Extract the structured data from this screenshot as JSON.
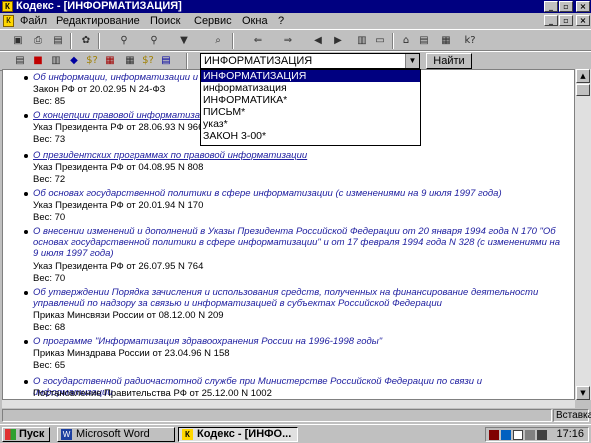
{
  "window": {
    "title": "Кодекс - [ИНФОРМАТИЗАЦИЯ]",
    "minimize": "_",
    "maximize": "▫",
    "close": "×"
  },
  "menu": [
    "Файл",
    "Редактирование",
    "Поиск",
    "Сервис",
    "Окна",
    "?"
  ],
  "search": {
    "value": "ИНФОРМАТИЗАЦИЯ",
    "button_label": "Найти",
    "options": [
      "ИНФОРМАТИЗАЦИЯ",
      "информатизация",
      "ИНФОРМАТИКА*",
      "ПИСЬМ*",
      "указ*",
      "ЗАКОН 3-00*"
    ]
  },
  "documents": [
    {
      "title": "Об информации, информатизации и защите информации",
      "info": "Закон РФ от 20.02.95 N 24-ФЗ",
      "weight": "Вес: 85",
      "underline": false
    },
    {
      "title": "О концепции правовой информатизации России",
      "info": "Указ Президента РФ от 28.06.93 N 966",
      "weight": "Вес: 73",
      "underline": true
    },
    {
      "title": "О президентских программах по правовой информатизации",
      "info": "Указ Президента РФ от 04.08.95 N 808",
      "weight": "Вес: 72",
      "underline": true
    },
    {
      "title": "Об основах государственной политики в сфере информатизации (с изменениями на 9 июля 1997 года)",
      "info": "Указ Президента РФ от 20.01.94 N 170",
      "weight": "Вес: 70",
      "underline": false
    },
    {
      "title": "О внесении изменений и дополнений в Указы Президента Российской Федерации от 20 января 1994 года N 170 \"Об основах государственной политики в сфере информатизации\" и от 17 февраля 1994 года N 328 (с изменениями на 9 июля 1997 года)",
      "info": "Указ Президента РФ от 26.07.95 N 764",
      "weight": "Вес: 70",
      "underline": false
    },
    {
      "title": "Об утверждении Порядка зачисления и использования средств, полученных на финансирование деятельности управлений по надзору за связью и информатизацией в субъектах Российской Федерации",
      "info": "Приказ Минсвязи России от 08.12.00 N 209",
      "weight": "Вес: 68",
      "underline": false
    },
    {
      "title": "О программе \"Информатизация здравоохранения России на 1996-1998 годы\"",
      "info": "Приказ Минздрава России от 23.04.96 N 158",
      "weight": "Вес: 65",
      "underline": false
    },
    {
      "title": "О государственной радиочастотной службе при Министерстве Российской Федерации по связи и информатизации",
      "info": "Постановление Правительства РФ от 25.12.00 N 1002",
      "weight": "",
      "underline": false
    }
  ],
  "status": {
    "mode": "Вставка"
  },
  "taskbar": {
    "start": "Пуск",
    "tasks": [
      "Microsoft Word",
      "Кодекс - [ИНФО..."
    ],
    "clock": "17:16"
  },
  "icons": {
    "app": "kodeks-app-icon",
    "dropdown_arrow": "chevron-down-icon"
  },
  "colors": {
    "titlebar": "#000080",
    "link": "#2020a0",
    "selection": "#000080"
  }
}
